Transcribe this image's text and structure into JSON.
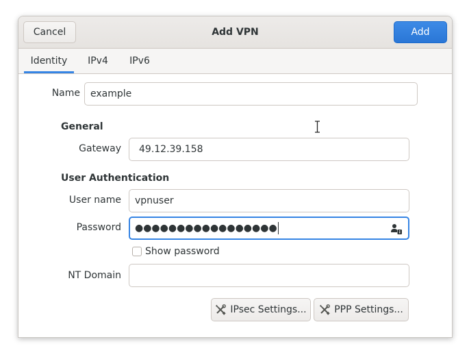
{
  "window": {
    "title": "Add VPN",
    "cancel_label": "Cancel",
    "add_label": "Add"
  },
  "tabs": [
    {
      "label": "Identity",
      "active": true
    },
    {
      "label": "IPv4",
      "active": false
    },
    {
      "label": "IPv6",
      "active": false
    }
  ],
  "identity": {
    "name_label": "Name",
    "name_value": "example"
  },
  "general": {
    "heading": "General",
    "gateway_label": "Gateway",
    "gateway_value": "49.12.39.158"
  },
  "auth": {
    "heading": "User Authentication",
    "username_label": "User name",
    "username_value": "vpnuser",
    "password_label": "Password",
    "password_masked": "●●●●●●●●●●●●●●●●●",
    "password_icon": "user-password-icon",
    "show_password_label": "Show password",
    "show_password_checked": false,
    "nt_domain_label": "NT Domain",
    "nt_domain_value": ""
  },
  "buttons": {
    "ipsec_label": "IPsec Settings...",
    "ppp_label": "PPP Settings...",
    "icon": "wrench-screwdriver-icon"
  },
  "colors": {
    "accent": "#3584e4",
    "add_button": "#2a76d6"
  }
}
